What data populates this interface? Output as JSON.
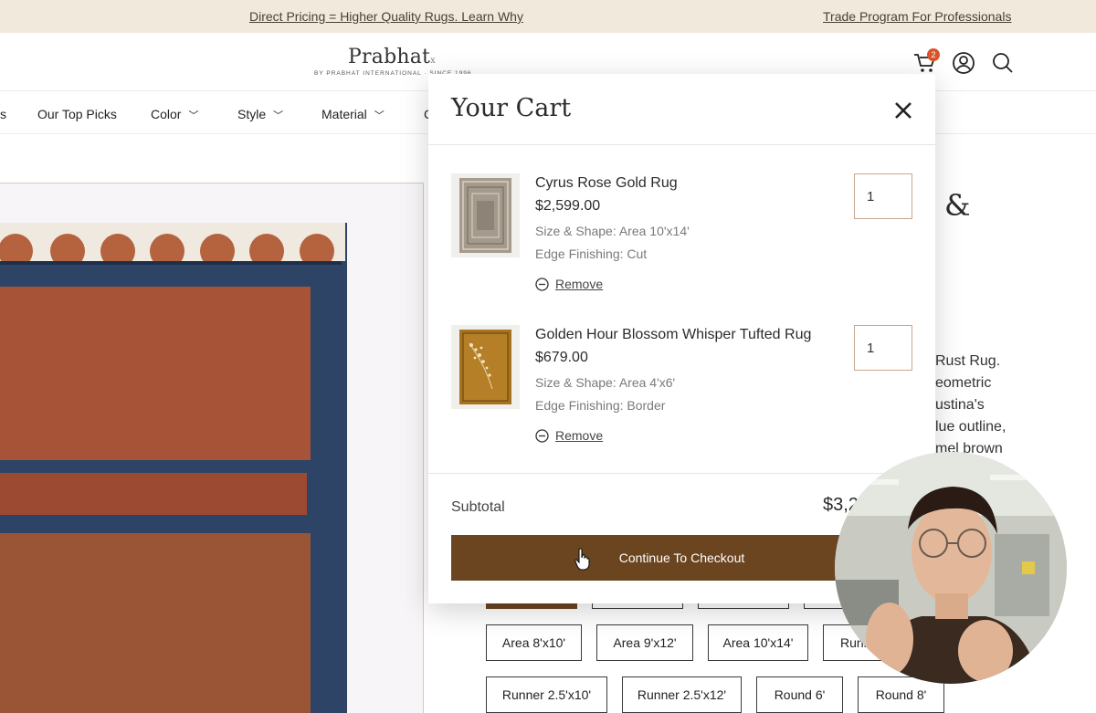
{
  "announcement": {
    "left_link": "Direct Pricing = Higher Quality Rugs. Learn Why",
    "right_link": "Trade Program For Professionals"
  },
  "header": {
    "logo_text": "Prabhat",
    "logo_sub": "BY PRABHAT INTERNATIONAL · SINCE 1996",
    "cart_count": "2",
    "icons": [
      "cart-icon",
      "account-icon",
      "search-icon"
    ]
  },
  "nav": {
    "items": [
      {
        "label": "s"
      },
      {
        "label": "Our Top Picks"
      },
      {
        "label": "Color"
      },
      {
        "label": "Style"
      },
      {
        "label": "Material"
      },
      {
        "label": "C"
      }
    ]
  },
  "product": {
    "title_fragment": "&",
    "description_lines": [
      "Rust Rug.",
      "eometric",
      "ustina's",
      "lue outline,",
      "mel brown"
    ]
  },
  "sizes": {
    "options": [
      {
        "label": "",
        "selected": true
      },
      {
        "label": ""
      },
      {
        "label": ""
      },
      {
        "label": ""
      },
      {
        "label": "Area 8'x10'"
      },
      {
        "label": "Area 9'x12'"
      },
      {
        "label": "Area 10'x14'"
      },
      {
        "label": "Runner"
      },
      {
        "label": "Runner 2.5'x10'"
      },
      {
        "label": "Runner 2.5'x12'"
      },
      {
        "label": "Round 6'"
      },
      {
        "label": "Round 8'"
      }
    ]
  },
  "cart": {
    "title": "Your Cart",
    "items": [
      {
        "name": "Cyrus Rose Gold Rug",
        "price": "$2,599.00",
        "size": "Size & Shape: Area 10'x14'",
        "edge": "Edge Finishing: Cut",
        "remove": "Remove",
        "qty": "1"
      },
      {
        "name": "Golden Hour Blossom Whisper Tufted Rug",
        "price": "$679.00",
        "size": "Size & Shape: Area 4'x6'",
        "edge": "Edge Finishing: Border",
        "remove": "Remove",
        "qty": "1"
      }
    ],
    "subtotal_label": "Subtotal",
    "subtotal_value": "$3,2",
    "checkout_label": "Continue To Checkout"
  },
  "colors": {
    "announce_bg": "#f2e9dd",
    "checkout_bg": "#6b4520",
    "rug_navy": "#2e4466",
    "rug_rust": "#a65337",
    "badge": "#d9542a"
  }
}
